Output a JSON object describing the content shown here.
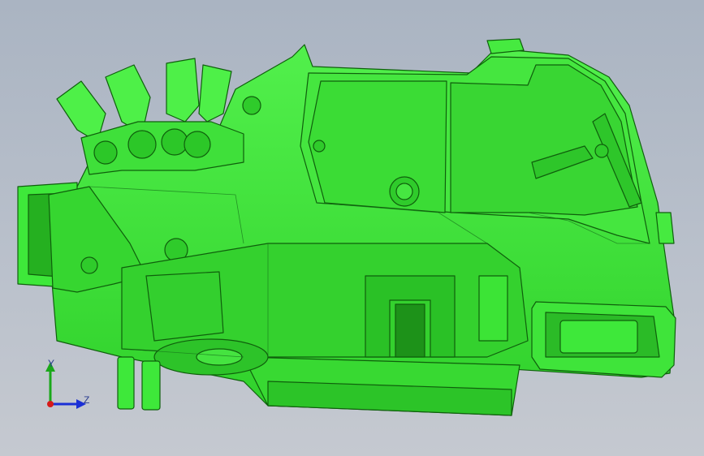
{
  "viewport": {
    "background_top": "#aab4c2",
    "background_bottom": "#c5c9d0"
  },
  "model": {
    "part_color": "#3ee83a",
    "part_shade": "#22a51f",
    "part_edge": "#0f5f0c"
  },
  "triad": {
    "y_label": "Y",
    "z_label": "Z",
    "y_color": "#1aa81a",
    "z_color": "#1a2fd6",
    "x_color": "#d61a1a"
  }
}
